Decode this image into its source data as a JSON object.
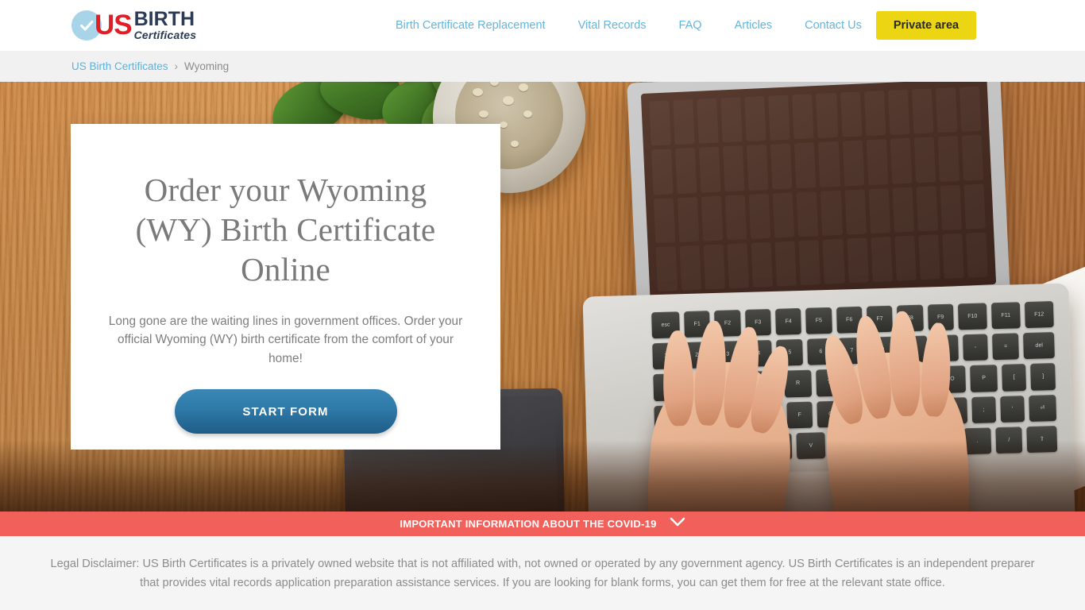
{
  "header": {
    "logo": {
      "check_icon": "check-circle-icon",
      "us": "US",
      "birth": "BIRTH",
      "certificates": "Certificates"
    },
    "nav": [
      {
        "label": "Birth Certificate Replacement"
      },
      {
        "label": "Vital Records"
      },
      {
        "label": "FAQ"
      },
      {
        "label": "Articles"
      },
      {
        "label": "Contact Us"
      }
    ],
    "private_area_label": "Private area",
    "private_area_color": "#ecd613",
    "nav_link_color": "#62b5df"
  },
  "breadcrumb": {
    "home_label": "US Birth Certificates",
    "separator": "›",
    "current_label": "Wyoming"
  },
  "hero": {
    "title": "Order your Wyoming (WY) Birth Certificate Online",
    "subtitle": "Long gone are the waiting lines in government offices. Order your official Wyoming (WY) birth certificate from the comfort of your home!",
    "cta_label": "START FORM",
    "cta_color": "#2e79a8"
  },
  "covid_banner": {
    "text": "IMPORTANT INFORMATION ABOUT THE COVID-19",
    "chevron_icon": "chevron-down-icon",
    "background_color": "#f2605c"
  },
  "disclaimer": {
    "text": "Legal Disclaimer: US Birth Certificates is a privately owned website that is not affiliated with, not owned or operated by any government agency. US Birth Certificates is an independent preparer that provides vital records application preparation assistance services. If you are looking for blank forms, you can get them for free at the relevant state office."
  }
}
